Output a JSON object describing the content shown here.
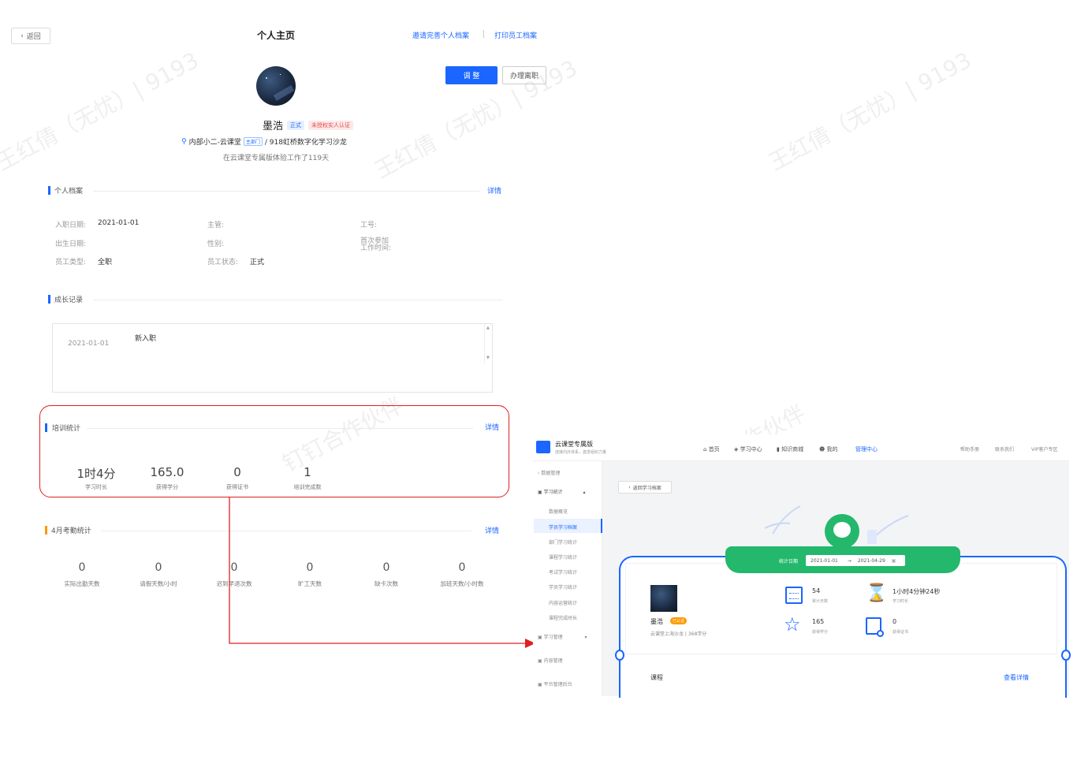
{
  "profile": {
    "back_label": "返回",
    "page_title": "个人主页",
    "invite_link": "邀请完善个人档案",
    "print_link": "打印员工档案",
    "adjust_button": "调 整",
    "resign_button": "办理离职",
    "name": "墨浩",
    "badge_status": "正式",
    "badge_auth": "未授权实人认证",
    "dept": "内部小二-云课堂",
    "dept_tag": "主部门",
    "dept_extra": "/ 918虹桥数字化学习沙龙",
    "tenure": "在云课堂专属版体验工作了119天"
  },
  "archive": {
    "title": "个人档案",
    "detail": "详情",
    "fields": {
      "hire_label": "入职日期:",
      "hire_value": "2021-01-01",
      "boss_label": "主管:",
      "jobno_label": "工号:",
      "birth_label": "出生日期:",
      "gender_label": "性别:",
      "first_work_label": "首次参加\n工作时间:",
      "type_label": "员工类型:",
      "type_value": "全职",
      "state_label": "员工状态:",
      "state_value": "正式"
    }
  },
  "growth": {
    "title": "成长记录",
    "date": "2021-01-01",
    "event": "新入职"
  },
  "training": {
    "title": "培训统计",
    "detail": "详情",
    "stats": [
      {
        "value": "1时4分",
        "label": "学习时长"
      },
      {
        "value": "165.0",
        "label": "获得学分"
      },
      {
        "value": "0",
        "label": "获得证书"
      },
      {
        "value": "1",
        "label": "培训完成数"
      }
    ]
  },
  "attendance": {
    "title": "4月考勤统计",
    "detail": "详情",
    "stats": [
      {
        "value": "0",
        "label": "实际出勤天数"
      },
      {
        "value": "0",
        "label": "请假天数/小时"
      },
      {
        "value": "0",
        "label": "迟到早退次数"
      },
      {
        "value": "0",
        "label": "旷工天数"
      },
      {
        "value": "0",
        "label": "缺卡次数"
      },
      {
        "value": "0",
        "label": "加班天数/小时数"
      }
    ]
  },
  "watermarks": [
    "王红倩（无忧）| 9193",
    "王红倩（无忧）| 9193",
    "王红倩（无忧）| 9193",
    "钉钉合作伙伴",
    "钉钉合作伙伴"
  ],
  "inset": {
    "brand": "云课堂专属版",
    "brand_sub": "连接内外体系，激发组织力量",
    "nav": [
      "首页",
      "学习中心",
      "知识商城",
      "我的",
      "管理中心"
    ],
    "nav_right": [
      "帮助手册",
      "联系我们",
      "VIP客户专区"
    ],
    "side": {
      "back": "数据管理",
      "group": "学习统计",
      "items": [
        "数据概览",
        "学员学习档案",
        "部门学习统计",
        "课程学习统计",
        "考试学习统计",
        "学员学习统计",
        "内容运营统计",
        "课程完成时长"
      ],
      "active_index": 1,
      "more": [
        "学习管理",
        "内容管理",
        "平台管理后台"
      ]
    },
    "back_archive": "返回学习档案",
    "stat_range_label": "统计日期",
    "date_from": "2021-01-01",
    "date_to": "2021-04-29",
    "user_name": "墨浩",
    "user_badge": "已认证",
    "user_dept": "云课堂上海沙龙 | 368学分",
    "stats": [
      {
        "value": "54",
        "label": "累计天数"
      },
      {
        "value": "1小时4分钟24秒",
        "label": "学习时长"
      },
      {
        "value": "165",
        "label": "获得学分"
      },
      {
        "value": "0",
        "label": "获得证书"
      }
    ],
    "course_label": "课程",
    "course_detail": "查看详情"
  },
  "colors": {
    "accent": "#1a66ff",
    "highlight": "#e02020",
    "green": "#23b86c",
    "orange": "#ff9900"
  }
}
